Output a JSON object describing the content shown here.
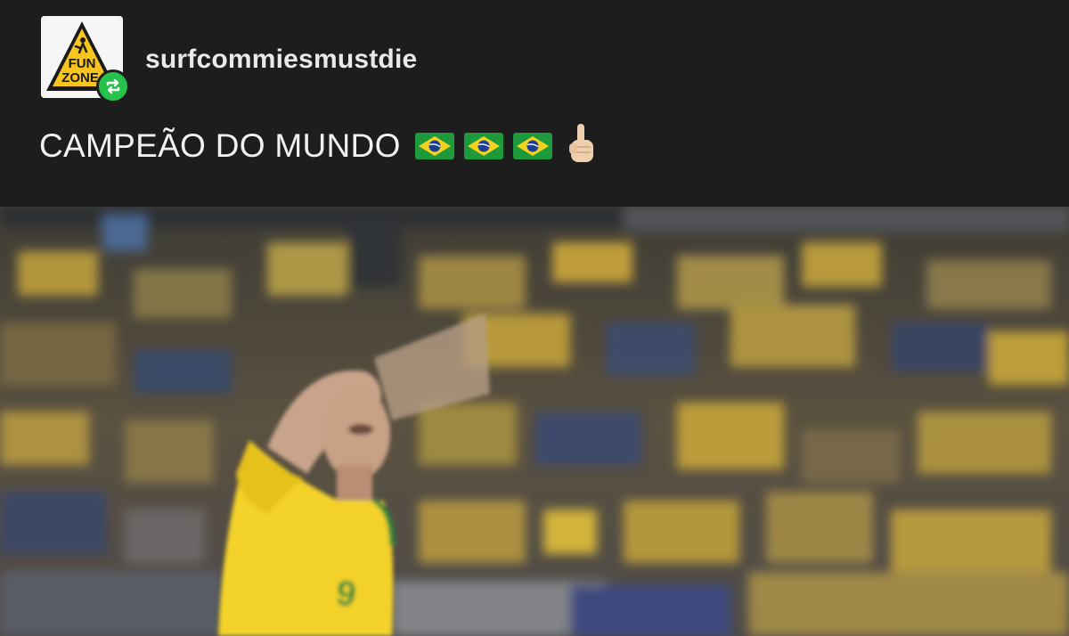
{
  "post": {
    "username": "surfcommiesmustdie",
    "avatar_label": "FUN ZONE",
    "avatar_icon": "fun-zone-warning-sign-icon",
    "reblog_icon": "reblog-icon",
    "caption": "CAMPEÃO DO MUNDO",
    "caption_emoji": [
      "flag-brazil-icon",
      "flag-brazil-icon",
      "flag-brazil-icon",
      "index-pointing-up-icon"
    ]
  },
  "media": {
    "type": "gif-frame",
    "jersey_number": "9",
    "colors": {
      "jersey": "#f3d22a",
      "crowd_yellow": "#c9a53a",
      "crowd_blue": "#34466c",
      "header_bg": "#1d1d1d",
      "reblog_green": "#27c24c"
    }
  }
}
